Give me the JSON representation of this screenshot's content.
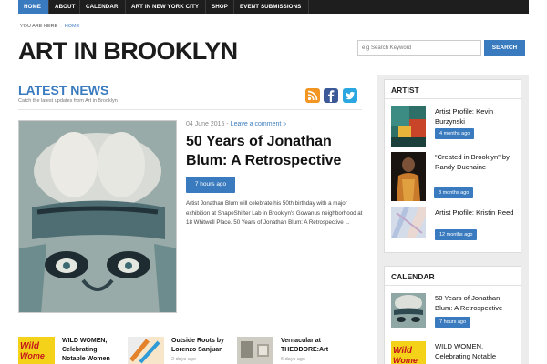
{
  "nav": {
    "items": [
      {
        "label": "HOME",
        "active": true
      },
      {
        "label": "ABOUT"
      },
      {
        "label": "CALENDAR"
      },
      {
        "label": "ART IN NEW YORK CITY"
      },
      {
        "label": "SHOP"
      },
      {
        "label": "EVENT SUBMISSIONS"
      }
    ]
  },
  "breadcrumb": {
    "prefix": "YOU ARE HERE",
    "separator": ":",
    "current": "HOME"
  },
  "site": {
    "title": "ART IN BROOKLYN"
  },
  "search": {
    "placeholder": "e.g Search Keyword",
    "button_label": "SEARCH"
  },
  "latest": {
    "heading": "LATEST NEWS",
    "subheading": "Catch the latest updates from Art in Brooklyn",
    "social_icons": [
      "rss-icon",
      "facebook-icon",
      "twitter-icon"
    ]
  },
  "featured": {
    "date": "04 June 2015",
    "separator": " - ",
    "comment_link": "Leave a comment »",
    "title": "50 Years of Jonathan Blum: A Retrospective",
    "badge": "7 hours ago",
    "excerpt": "Artist Jonathan Blum will celebrate his 50th birthday with a major exhibition at ShapeShifter Lab in Brooklyn's Gowanus neighborhood at 18 Whitwell Place. 50 Years of Jonathan Blum: A Retrospective ..."
  },
  "bottom_articles": [
    {
      "title_line1": "WILD WOMEN,",
      "title_line2": "Celebrating",
      "title_line3": "Notable Women",
      "date": ""
    },
    {
      "title_line1": "Outside Roots by",
      "title_line2": "Lorenzo Sanjuan",
      "title_line3": "",
      "date": "2 days ago"
    },
    {
      "title_line1": "Vernacular at",
      "title_line2": "THEODORE:Art",
      "title_line3": "",
      "date": "6 days ago"
    }
  ],
  "sidebar": {
    "artist": {
      "title": "ARTIST",
      "items": [
        {
          "title": "Artist Profile: Kevin Burzynski",
          "badge": "4 months ago"
        },
        {
          "title": "“Created in Brooklyn” by Randy Duchaine",
          "badge": "8 months ago"
        },
        {
          "title": "Artist Profile: Kristin Reed",
          "badge": "12 months ago"
        }
      ]
    },
    "calendar": {
      "title": "CALENDAR",
      "items": [
        {
          "title": "50 Years of Jonathan Blum: A Retrospective",
          "badge": "7 hours ago"
        },
        {
          "title": "WILD WOMEN, Celebrating Notable Women You May Have",
          "badge": ""
        }
      ]
    }
  },
  "colors": {
    "accent": "#3a7bbf",
    "nav_bg": "#1e1e1e",
    "sidebar_bg": "#ececec"
  }
}
